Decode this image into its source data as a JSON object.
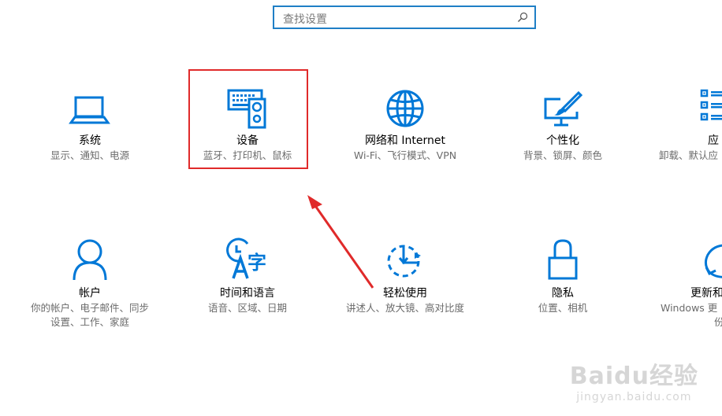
{
  "search": {
    "placeholder": "查找设置"
  },
  "tiles": [
    {
      "id": "system",
      "title": "系统",
      "desc": "显示、通知、电源",
      "icon": "laptop-icon"
    },
    {
      "id": "devices",
      "title": "设备",
      "desc": "蓝牙、打印机、鼠标",
      "icon": "devices-icon"
    },
    {
      "id": "network",
      "title": "网络和 Internet",
      "desc": "Wi-Fi、飞行模式、VPN",
      "icon": "globe-icon"
    },
    {
      "id": "personalization",
      "title": "个性化",
      "desc": "背景、锁屏、颜色",
      "icon": "paint-brush-monitor-icon"
    },
    {
      "id": "apps",
      "title": "应",
      "desc": "卸载、默认应",
      "icon": "app-list-icon"
    },
    {
      "id": "accounts",
      "title": "帐户",
      "desc": "你的帐户、电子邮件、同步",
      "desc2": "设置、工作、家庭",
      "icon": "person-icon"
    },
    {
      "id": "time-language",
      "title": "时间和语言",
      "desc": "语音、区域、日期",
      "icon": "time-language-icon"
    },
    {
      "id": "ease-of-access",
      "title": "轻松使用",
      "desc": "讲述人、放大镜、高对比度",
      "icon": "ease-of-access-icon"
    },
    {
      "id": "privacy",
      "title": "隐私",
      "desc": "位置、相机",
      "icon": "lock-icon"
    },
    {
      "id": "update",
      "title": "更新和",
      "desc": "Windows 更",
      "desc2": "份",
      "icon": "refresh-icon"
    }
  ],
  "watermark": {
    "logo": "Baidu经验",
    "url": "jingyan.baidu.com"
  },
  "colors": {
    "accent": "#0078d7",
    "highlight_border": "#e02a2a",
    "arrow": "#e02a2a"
  }
}
